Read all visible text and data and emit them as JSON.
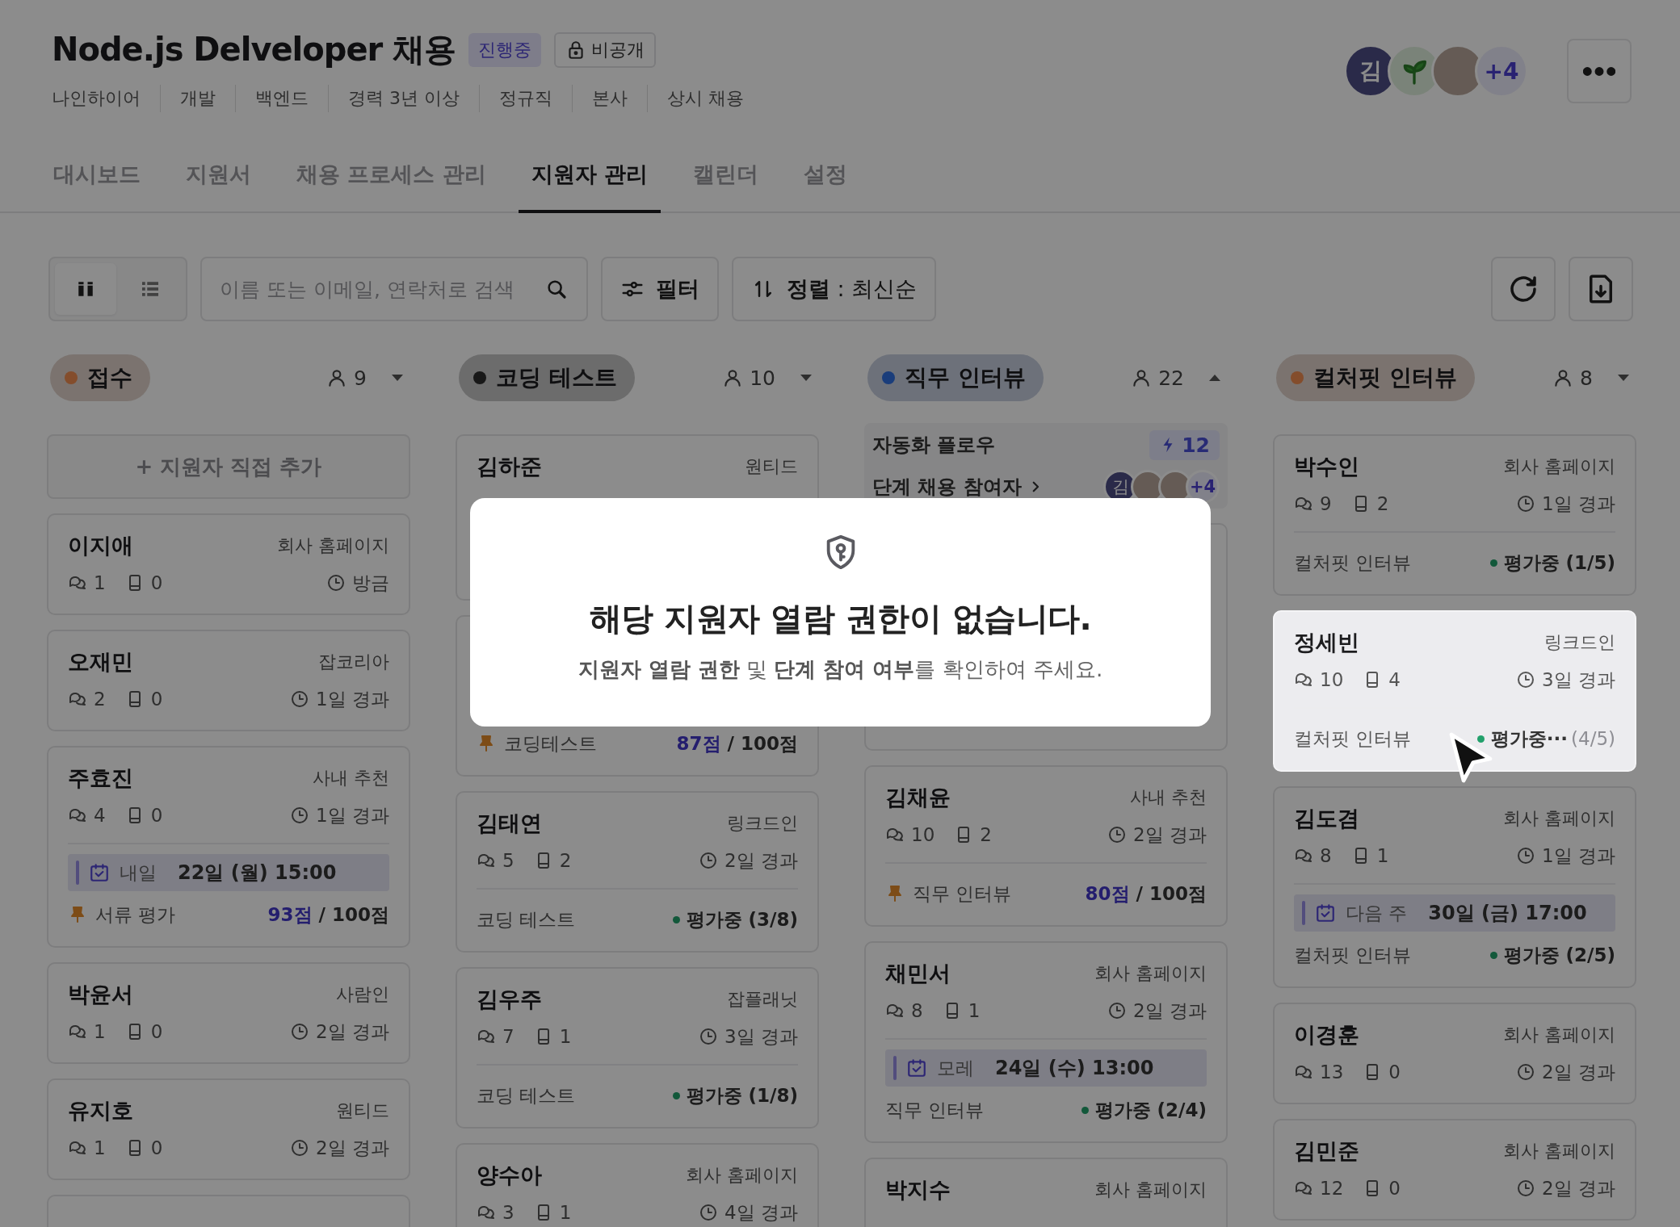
{
  "header": {
    "title": "Node.js Delveloper 채용",
    "status_badge": "진행중",
    "visibility": "비공개",
    "tags": [
      "나인하이어",
      "개발",
      "백엔드",
      "경력 3년 이상",
      "정규직",
      "본사",
      "상시 채용"
    ],
    "members": [
      {
        "kind": "initial",
        "text": "김"
      },
      {
        "kind": "sprout"
      },
      {
        "kind": "photo"
      }
    ],
    "members_more": "+4"
  },
  "tabs": [
    {
      "label": "대시보드",
      "selected": false
    },
    {
      "label": "지원서",
      "selected": false
    },
    {
      "label": "채용 프로세스 관리",
      "selected": false
    },
    {
      "label": "지원자 관리",
      "selected": true
    },
    {
      "label": "캘린더",
      "selected": false
    },
    {
      "label": "설정",
      "selected": false
    }
  ],
  "toolbar": {
    "views": [
      {
        "kind": "board",
        "selected": true
      },
      {
        "kind": "list",
        "selected": false
      }
    ],
    "search_placeholder": "이름 또는 이메일, 연락처로 검색",
    "filter": "필터",
    "sort": "**정렬** : 최신순"
  },
  "columns": [
    {
      "title": "접수",
      "color": "#844d2c",
      "count": "9",
      "expanded": false,
      "add_label": "+ 지원자 직접 추가",
      "cards": [
        {
          "name": "이지애",
          "source": "회사 홈페이지",
          "comments": "1",
          "memos": "0",
          "elapsed": "방금",
          "highlighted": false
        },
        {
          "name": "오재민",
          "source": "잡코리아",
          "comments": "2",
          "memos": "0",
          "elapsed": "1일 경과",
          "highlighted": false
        },
        {
          "name": "주효진",
          "source": "사내 추천",
          "comments": "4",
          "memos": "0",
          "elapsed": "1일 경과",
          "highlighted": false,
          "schedule": {
            "when": "내일",
            "time": "22일 (월) 15:00"
          },
          "footer": {
            "kind": "score",
            "stage": "서류 평가",
            "score": "93점",
            "total": " / 100점"
          }
        },
        {
          "name": "박윤서",
          "source": "사람인",
          "comments": "1",
          "memos": "0",
          "elapsed": "2일 경과",
          "highlighted": false
        },
        {
          "name": "유지호",
          "source": "원티드",
          "comments": "1",
          "memos": "0",
          "elapsed": "2일 경과",
          "highlighted": false
        },
        {
          "highlighted": false
        }
      ]
    },
    {
      "title": "코딩 테스트",
      "color": "#181818",
      "count": "10",
      "expanded": false,
      "cards": [
        {
          "name": "김하준",
          "source": "원티드",
          "highlighted": false
        },
        {
          "highlighted": false,
          "footer": {
            "kind": "score",
            "stage": "코딩테스트",
            "score": "87점",
            "total": " / 100점"
          }
        },
        {
          "name": "김태연",
          "source": "링크드인",
          "comments": "5",
          "memos": "2",
          "elapsed": "2일 경과",
          "highlighted": false,
          "footer": {
            "kind": "status",
            "stage": "코딩 테스트",
            "status": "평가중 (3/8)"
          }
        },
        {
          "name": "김우주",
          "source": "잡플래닛",
          "comments": "7",
          "memos": "1",
          "elapsed": "3일 경과",
          "highlighted": false,
          "footer": {
            "kind": "status",
            "stage": "코딩 테스트",
            "status": "평가중 (1/8)"
          }
        },
        {
          "name": "양수아",
          "source": "회사 홈페이지",
          "comments": "3",
          "memos": "1",
          "elapsed": "4일 경과",
          "highlighted": false
        }
      ]
    },
    {
      "title": "직무 인터뷰",
      "color": "#1a3d7b",
      "count": "22",
      "expanded": true,
      "automation": {
        "label": "자동화 플로우",
        "count": "12"
      },
      "participants": {
        "label": "단계 채용 참여자",
        "avatars": [
          {
            "kind": "initial",
            "text": "김"
          },
          {
            "kind": "photo"
          },
          {
            "kind": "photo"
          }
        ],
        "more": "+4"
      },
      "cards": [
        {
          "covered": true,
          "highlighted": false
        },
        {
          "name": "김채윤",
          "source": "사내 추천",
          "comments": "10",
          "memos": "2",
          "elapsed": "2일 경과",
          "highlighted": false,
          "footer": {
            "kind": "score",
            "stage": "직무 인터뷰",
            "score": "80점",
            "total": " / 100점"
          }
        },
        {
          "name": "채민서",
          "source": "회사 홈페이지",
          "comments": "8",
          "memos": "1",
          "elapsed": "2일 경과",
          "highlighted": false,
          "schedule": {
            "when": "모레",
            "time": "24일 (수) 13:00"
          },
          "footer": {
            "kind": "status",
            "stage": "직무 인터뷰",
            "status": "평가중 (2/4)"
          }
        },
        {
          "name": "박지수",
          "source": "회사 홈페이지",
          "highlighted": false
        }
      ]
    },
    {
      "title": "컬처핏 인터뷰",
      "color": "#844d2c",
      "count": "8",
      "expanded": false,
      "cards": [
        {
          "name": "박수인",
          "source": "회사 홈페이지",
          "comments": "9",
          "memos": "2",
          "elapsed": "1일 경과",
          "highlighted": false,
          "footer": {
            "kind": "status",
            "stage": "컬처핏 인터뷰",
            "status": "평가중 (1/5)"
          }
        },
        {
          "name": "정세빈",
          "source": "링크드인",
          "comments": "10",
          "memos": "4",
          "elapsed": "3일 경과",
          "highlighted": true,
          "footer": {
            "kind": "status",
            "stage": "컬처핏 인터뷰",
            "status": "평가중···",
            "status_faded": "(4/5)"
          }
        },
        {
          "name": "김도겸",
          "source": "회사 홈페이지",
          "comments": "8",
          "memos": "1",
          "elapsed": "1일 경과",
          "highlighted": false,
          "schedule": {
            "when": "다음 주",
            "time": "30일 (금) 17:00"
          },
          "footer": {
            "kind": "status",
            "stage": "컬처핏 인터뷰",
            "status": "평가중 (2/5)"
          }
        },
        {
          "name": "이경훈",
          "source": "회사 홈페이지",
          "comments": "13",
          "memos": "0",
          "elapsed": "2일 경과",
          "highlighted": false
        },
        {
          "name": "김민준",
          "source": "회사 홈페이지",
          "comments": "12",
          "memos": "0",
          "elapsed": "2일 경과",
          "highlighted": false
        }
      ]
    }
  ],
  "modal": {
    "title": "해당 지원자 열람 권한이 없습니다.",
    "message": "**지원자 열람 권한** 및 **단계 참여 여부**를 확인하여 주세요."
  }
}
